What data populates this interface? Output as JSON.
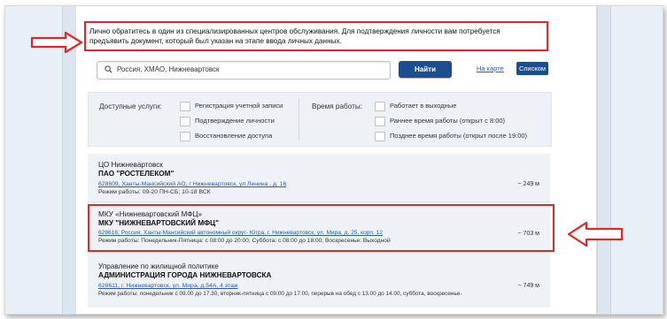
{
  "notice": {
    "line1": "Лично обратитесь в один из специализированных центров обслуживания. Для подтверждения личности вам потребуется",
    "line2": "предъявить документ, который был указан на этапе ввода личных данных."
  },
  "search": {
    "value": "Россия, ХМАО, Нижневартовск",
    "find_label": "Найти",
    "map_label": "На карте",
    "list_label": "Списком"
  },
  "filters": {
    "services_title": "Доступные услуги:",
    "services": [
      {
        "label": "Регистрация учетной записи",
        "checked": false
      },
      {
        "label": "Подтверждение личности",
        "checked": false
      },
      {
        "label": "Восстановление доступа",
        "checked": false
      }
    ],
    "hours_title": "Время работы:",
    "hours": [
      {
        "label": "Работает в выходные",
        "checked": false
      },
      {
        "label": "Раннее время работы (открыт с 8:00)",
        "checked": false
      },
      {
        "label": "Позднее время работы (открыт после 19:00)",
        "checked": false
      }
    ]
  },
  "results": [
    {
      "type": "ЦО Нижневартовск",
      "name": "ПАО \"РОСТЕЛЕКОМ\"",
      "address": "628609, Ханты-Мансийский АО, г Нижневартовск, ул Ленина , д. 16",
      "hours": "Режим работы: 09-20 ПН-СБ; 10-18 ВСК",
      "distance": "~ 249 м"
    },
    {
      "type": "МКУ «Нижневартовский МФЦ»",
      "name": "МКУ \"НИЖНЕВАРТОВСКИЙ МФЦ\"",
      "address": "628616, Россия, Ханты-Мансийский автономный округ- Югра, г. Нижневартовск, ул. Мира, д. 25, корп. 12",
      "hours": "Режим работы: Понедельник-Пятница: с 08:00 до 20:00; Суббота: с 08:00 до 18:00; Воскресенье: Выходной",
      "distance": "~ 703 м"
    },
    {
      "type": "Управление по жилищной политике",
      "name": "АДМИНИСТРАЦИЯ ГОРОДА НИЖНЕВАРТОВСКА",
      "address": "628611, г. Нижневартовск, ул. Мира, д.54А, 4 этаж",
      "hours": "Режим работы: понедельник с 09.00 до 17.30, вторник-пятница с 09.00 до 17.00, перерыв на обед с 13.00 до 14.00, суббота, воскресенье-",
      "distance": "~ 749 м"
    }
  ],
  "colors": {
    "accent": "#1a4e8f",
    "highlight": "#e3262a",
    "link": "#2a5da8"
  }
}
